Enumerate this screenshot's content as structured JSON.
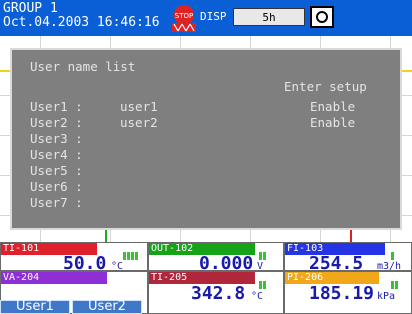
{
  "header": {
    "group_label": "GROUP 1",
    "datetime": "Oct.04.2003 16:46:16",
    "stop_icon": "stop-icon",
    "stop_text": "STOP",
    "disp_label": "DISP",
    "disp_value": "5h",
    "display_icon": "square-icon"
  },
  "dialog": {
    "title": "User name list",
    "right_heading": "Enter setup",
    "users": [
      {
        "label": "User1 :",
        "name": "user1",
        "status": "Enable"
      },
      {
        "label": "User2 :",
        "name": "user2",
        "status": "Enable"
      },
      {
        "label": "User3 :",
        "name": "",
        "status": ""
      },
      {
        "label": "User4 :",
        "name": "",
        "status": ""
      },
      {
        "label": "User5 :",
        "name": "",
        "status": ""
      },
      {
        "label": "User6 :",
        "name": "",
        "status": ""
      },
      {
        "label": "User7 :",
        "name": "",
        "status": ""
      }
    ]
  },
  "channels": [
    {
      "tag": "TI-101",
      "value": "50.0",
      "unit": "°C",
      "color": "#e0202a"
    },
    {
      "tag": "OUT-102",
      "value": "0.000",
      "unit": "V",
      "color": "#17a317"
    },
    {
      "tag": "FI-103",
      "value": "254.5",
      "unit": "m3/h",
      "color": "#2535e6"
    },
    {
      "tag": "VA-204",
      "value": "",
      "unit": "",
      "color": "#8e2fd6"
    },
    {
      "tag": "TI-205",
      "value": "342.8",
      "unit": "°C",
      "color": "#b0263a"
    },
    {
      "tag": "PI-206",
      "value": "185.19",
      "unit": "kPa",
      "color": "#f0a81a"
    }
  ],
  "softkeys": [
    {
      "label": "User1"
    },
    {
      "label": "User2"
    }
  ],
  "colors": {
    "header_bg": "#0a5fd6",
    "dialog_bg": "#7f7f7f",
    "value_text": "#1a1aaa",
    "bar_green": "#35c435"
  }
}
